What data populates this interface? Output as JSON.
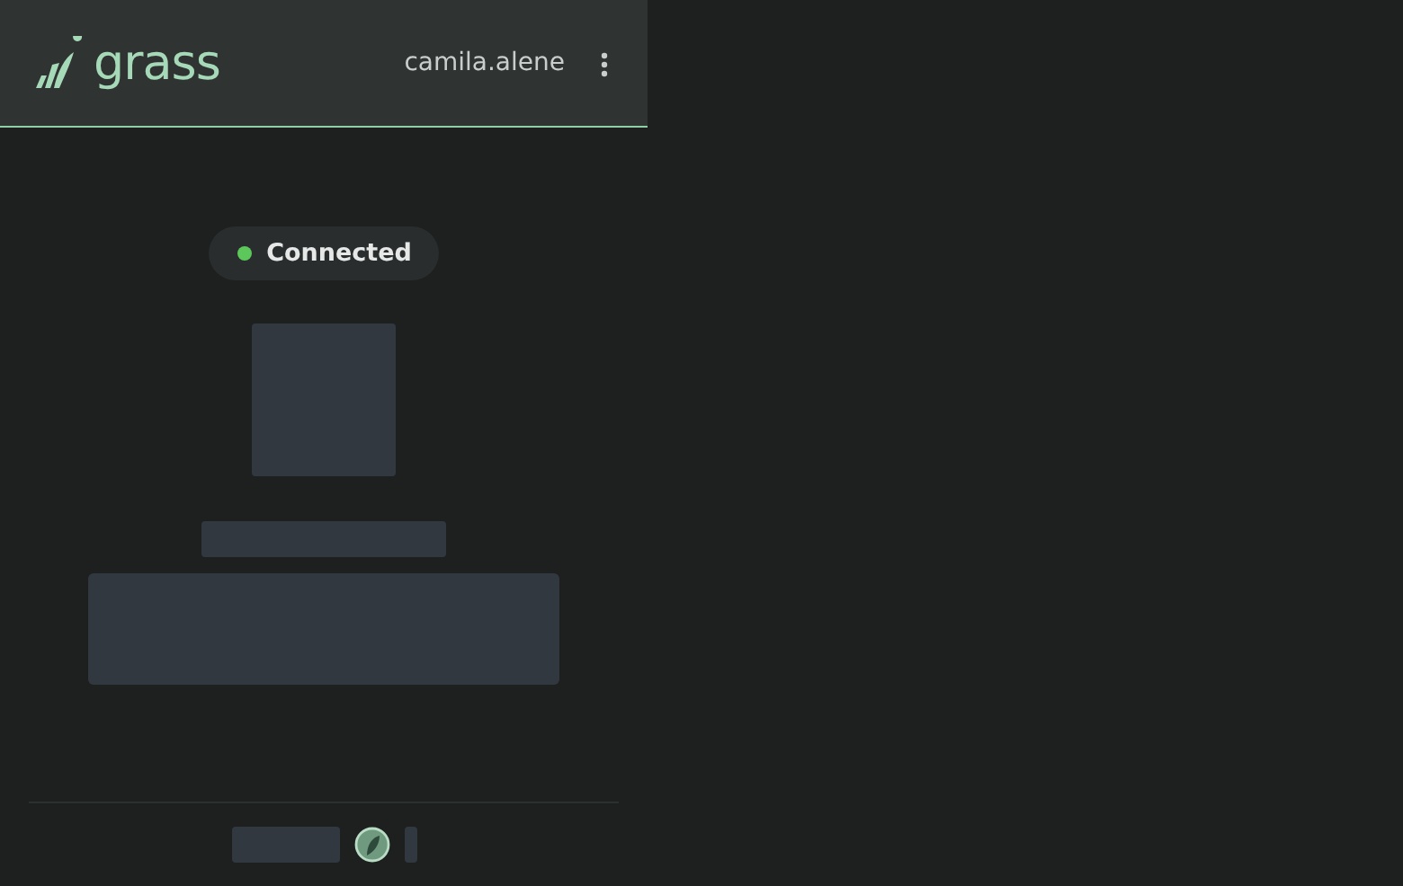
{
  "header": {
    "logo": "grass",
    "username": "camila.alene"
  },
  "status": {
    "label": "Connected",
    "connected": true
  }
}
